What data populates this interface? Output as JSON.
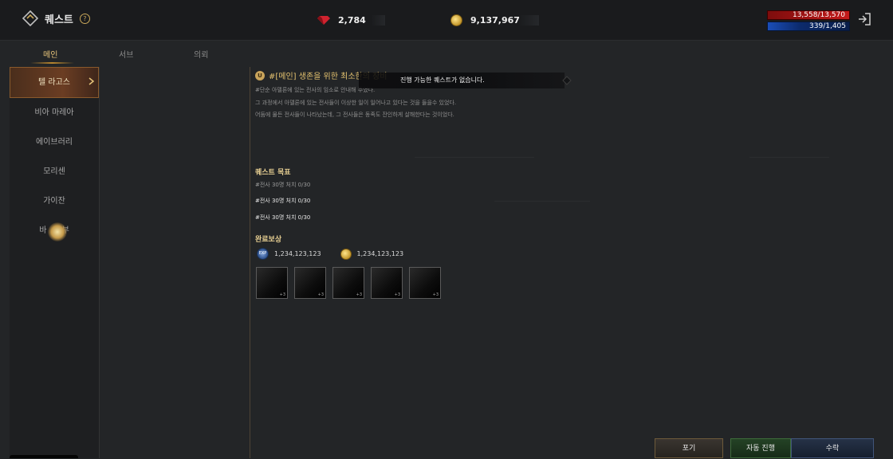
{
  "header": {
    "title": "퀘스트",
    "help_icon": "question-icon",
    "gems": "2,784",
    "gold": "9,137,967",
    "hp": "13,558/13,570",
    "mp": "339/1,405",
    "colors": {
      "hp": "#c41a1a",
      "mp": "#1a4db8",
      "accent": "#e7c47a"
    }
  },
  "tabs": [
    {
      "label": "메인",
      "active": true
    },
    {
      "label": "서브",
      "active": false
    },
    {
      "label": "의뢰",
      "active": false
    }
  ],
  "sidebar": {
    "items": [
      {
        "label": "텔 라고스",
        "active": true
      },
      {
        "label": "비아 마레아"
      },
      {
        "label": "에이브러리"
      },
      {
        "label": "모리센"
      },
      {
        "label": "가이잔"
      },
      {
        "label": "바"
      },
      {
        "label": "부"
      }
    ]
  },
  "quest": {
    "badge": "U",
    "name": "#[메인] 생존을 위한 최소한의 장비",
    "desc": [
      "#단순 아델론에 있는 전사의 임소로 안내해 주었다.",
      "그 과정에서 아델론에 있는 전사들이 이상한 일이 일어나고 있다는 것을 들을수 있었다.",
      "어둠에 물든 전사들이 나타났는데, 그 전사들은 동족도 잔인하게 살해한다는 것이었다."
    ],
    "toast": "진행 가능한 퀘스트가 없습니다."
  },
  "objectives": {
    "title": "퀘스트 목표",
    "items": [
      "#전사 30명 처치 0/30",
      "#전사 30명 처치 0/30",
      "#전사 30명 처치 0/30"
    ]
  },
  "rewards": {
    "title": "완료보상",
    "exp_icon_label": "EXP",
    "exp": "1,234,123,123",
    "gold": "1,234,123,123",
    "slots": [
      "+3",
      "+3",
      "+3",
      "+3",
      "+3"
    ]
  },
  "buttons": {
    "give_up": "포기",
    "auto": "자동 진행",
    "accept": "수락"
  }
}
